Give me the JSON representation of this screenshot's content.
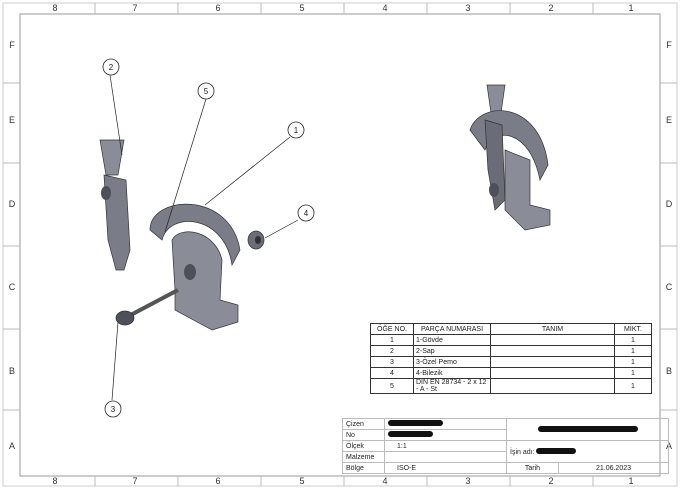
{
  "zones": {
    "columns": [
      "8",
      "7",
      "6",
      "5",
      "4",
      "3",
      "2",
      "1"
    ],
    "rows": [
      "F",
      "E",
      "D",
      "C",
      "B",
      "A"
    ]
  },
  "balloons": [
    "1",
    "2",
    "3",
    "4",
    "5"
  ],
  "bom": {
    "headers": [
      "ÖĞE NO.",
      "PARÇA NUMARASI",
      "TANIM",
      "MİKT."
    ],
    "rows": [
      {
        "no": "1",
        "part": "1-Gövde",
        "desc": "",
        "qty": "1"
      },
      {
        "no": "2",
        "part": "2-Sap",
        "desc": "",
        "qty": "1"
      },
      {
        "no": "3",
        "part": "3-Özel Pemo",
        "desc": "",
        "qty": "1"
      },
      {
        "no": "4",
        "part": "4-Bilezik",
        "desc": "",
        "qty": "1"
      },
      {
        "no": "5",
        "part": "DIN EN 28734 - 2 x 12 - A - St",
        "desc": "",
        "qty": "1"
      }
    ]
  },
  "title_block": {
    "cizen_label": "Çizen",
    "no_label": "No",
    "olcek_label": "Ölçek",
    "olcek_value": "1:1",
    "malzeme_label": "Malzeme",
    "bolge_label": "Bölge",
    "bolge_value": "ISO-E",
    "isin_adi_label": "İşin adı:",
    "tarih_label": "Tarih",
    "tarih_value": "21.06.2023"
  },
  "colors": {
    "part": "#7a7d88",
    "part_dark": "#4d5059",
    "part_light": "#a9acb6",
    "line": "#222222"
  }
}
